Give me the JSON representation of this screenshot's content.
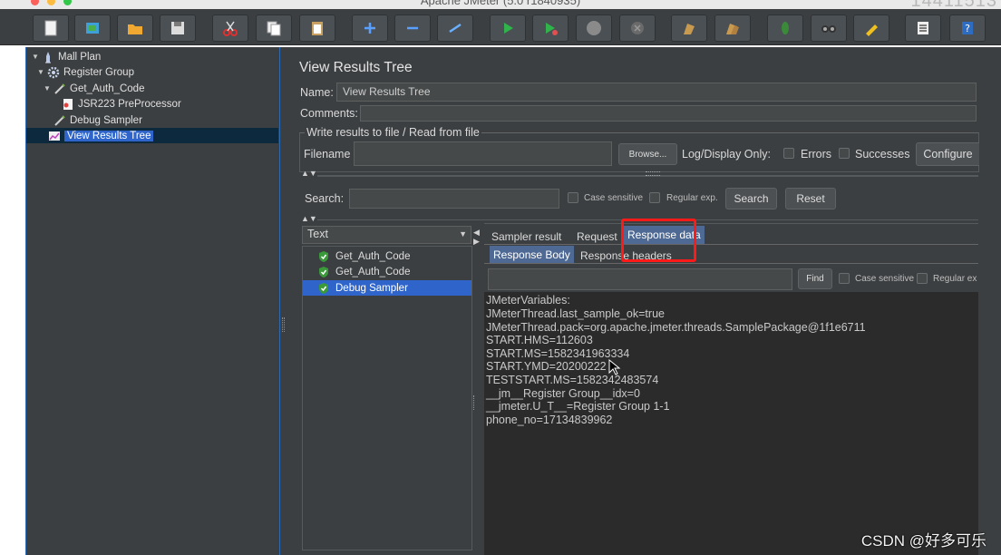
{
  "window": {
    "title": "Apache JMeter (5.0 r1840935)",
    "counter_overlay": "14411513"
  },
  "colors": {
    "selection": "#2f65ca",
    "highlight_box": "#ff1a1a",
    "panel_bg": "#3c3f41"
  },
  "toolbar": {
    "buttons": [
      "new-icon",
      "templates-icon",
      "open-icon",
      "save-icon",
      "cut-icon",
      "copy-icon",
      "paste-icon",
      "expand-icon",
      "collapse-icon",
      "toggle-icon",
      "start-icon",
      "start-no-pause-icon",
      "stop-icon",
      "shutdown-icon",
      "clear-icon",
      "clear-all-icon",
      "search-icon",
      "reset-search-icon",
      "function-helper-icon",
      "list-icon",
      "help-icon"
    ]
  },
  "tree": {
    "items": [
      {
        "label": "Mall Plan",
        "icon": "test-plan-icon",
        "expanded": true
      },
      {
        "label": "Register Group",
        "icon": "gear-icon",
        "expanded": true
      },
      {
        "label": "Get_Auth_Code",
        "icon": "pipette-icon",
        "expanded": true
      },
      {
        "label": "JSR223 PreProcessor",
        "icon": "script-icon"
      },
      {
        "label": "Debug Sampler",
        "icon": "pipette-icon"
      },
      {
        "label": "View Results Tree",
        "icon": "graph-icon",
        "selected": true
      }
    ]
  },
  "panel": {
    "title": "View Results Tree",
    "name_label": "Name:",
    "name_value": "View Results Tree",
    "comments_label": "Comments:",
    "comments_value": "",
    "file_group_title": "Write results to file / Read from file",
    "filename_label": "Filename",
    "filename_value": "",
    "browse_button": "Browse...",
    "log_display_label": "Log/Display Only:",
    "errors_label": "Errors",
    "successes_label": "Successes",
    "configure_button": "Configure"
  },
  "search": {
    "label": "Search:",
    "value": "",
    "case_sensitive_label": "Case sensitive",
    "regex_label": "Regular exp.",
    "search_button": "Search",
    "reset_button": "Reset"
  },
  "renderer": {
    "selected": "Text"
  },
  "results": [
    {
      "label": "Get_Auth_Code"
    },
    {
      "label": "Get_Auth_Code"
    },
    {
      "label": "Debug Sampler",
      "selected": true
    }
  ],
  "tabs": [
    "Sampler result",
    "Request",
    "Response data"
  ],
  "active_tab": "Response data",
  "subtabs": [
    "Response Body",
    "Response headers"
  ],
  "active_subtab": "Response Body",
  "find": {
    "value": "",
    "find_button": "Find",
    "case_sensitive_label": "Case sensitive",
    "regex_label": "Regular ex"
  },
  "response_lines": [
    "JMeterVariables:",
    "JMeterThread.last_sample_ok=true",
    "JMeterThread.pack=org.apache.jmeter.threads.SamplePackage@1f1e6711",
    "START.HMS=112603",
    "START.MS=1582341963334",
    "START.YMD=20200222",
    "TESTSTART.MS=1582342483574",
    "__jm__Register Group__idx=0",
    "__jmeter.U_T__=Register Group 1-1",
    "phone_no=17134839962"
  ],
  "watermark": "CSDN @好多可乐"
}
